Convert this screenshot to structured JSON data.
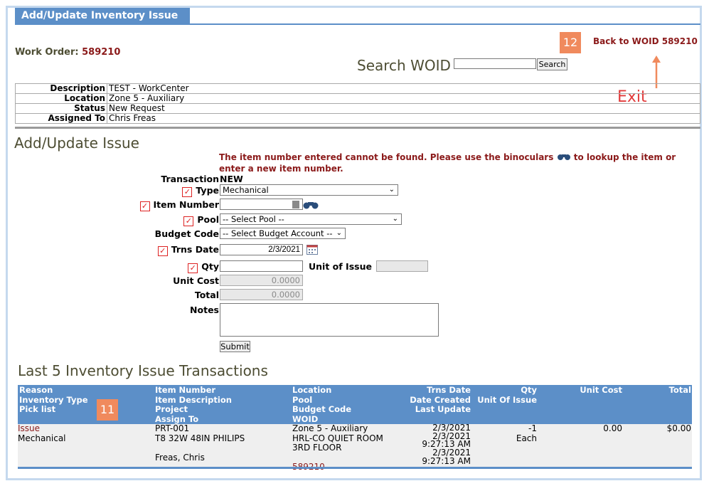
{
  "header": {
    "tab_title": "Add/Update Inventory Issue"
  },
  "work_order": {
    "label": "Work Order:",
    "number": "589210"
  },
  "search": {
    "label": "Search WOID",
    "input_value": "",
    "button": "Search"
  },
  "back_link": "Back to WOID 589210",
  "annotations": {
    "badge_12": "12",
    "badge_11": "11",
    "exit_label": "Exit"
  },
  "info": [
    {
      "key": "Description",
      "value": "TEST - WorkCenter"
    },
    {
      "key": "Location",
      "value": "Zone 5 - Auxiliary"
    },
    {
      "key": "Status",
      "value": "New Request"
    },
    {
      "key": "Assigned To",
      "value": "Chris Freas"
    }
  ],
  "form": {
    "section_title": "Add/Update Issue",
    "error": "The item number entered cannot be found. Please use the binoculars",
    "error_after": "to lookup the item or enter a new item number.",
    "transaction_label": "Transaction",
    "transaction_value": "NEW",
    "type_label": "Type",
    "type_value": "Mechanical",
    "item_number_label": "Item Number",
    "item_number_value": "",
    "pool_label": "Pool",
    "pool_value": "-- Select Pool --",
    "budget_label": "Budget Code",
    "budget_value": "-- Select Budget Account --",
    "trns_date_label": "Trns Date",
    "trns_date_value": "2/3/2021",
    "qty_label": "Qty",
    "qty_value": "",
    "uoi_label": "Unit of Issue",
    "uoi_value": "",
    "unit_cost_label": "Unit Cost",
    "unit_cost_value": "0.0000",
    "total_label": "Total",
    "total_value": "0.0000",
    "notes_label": "Notes",
    "notes_value": "",
    "submit": "Submit",
    "check_mark": "✓"
  },
  "last5": {
    "title": "Last 5 Inventory Issue Transactions",
    "headers": {
      "c1": [
        "Reason",
        "Inventory Type",
        "Pick list"
      ],
      "c2": [
        "Item Number",
        "Item Description",
        "Project",
        "Assign To"
      ],
      "c3": [
        "Location",
        "Pool",
        "Budget Code",
        "WOID"
      ],
      "c4": [
        "Trns Date",
        "Date Created",
        "Last Update"
      ],
      "c5": [
        "Qty",
        "Unit Of Issue"
      ],
      "c6": "Unit Cost",
      "c7": "Total"
    },
    "row": {
      "reason": "Issue",
      "inventory_type": "Mechanical",
      "item_number": "PRT-001",
      "item_description": "T8 32W 48IN PHILIPS",
      "assign_to": "Freas, Chris",
      "location": "Zone 5 - Auxiliary",
      "pool": "HRL-CO QUIET ROOM",
      "pool2": "3RD FLOOR",
      "woid": "589210",
      "trns_date": "2/3/2021",
      "date_created_date": "2/3/2021",
      "date_created_time": "9:27:13 AM",
      "last_update_date": "2/3/2021",
      "last_update_time": "9:27:13 AM",
      "qty": "-1",
      "unit_of_issue": "Each",
      "unit_cost": "0.00",
      "total": "$0.00"
    }
  }
}
